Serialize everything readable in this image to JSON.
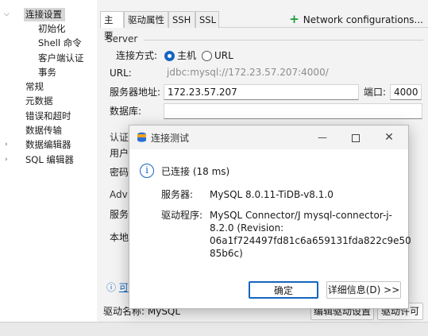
{
  "tree": {
    "items": [
      {
        "label": "连接设置",
        "expanded": true
      },
      {
        "label": "初始化"
      },
      {
        "label": "Shell 命令"
      },
      {
        "label": "客户端认证"
      },
      {
        "label": "事务"
      },
      {
        "label": "常规"
      },
      {
        "label": "元数据"
      },
      {
        "label": "错误和超时"
      },
      {
        "label": "数据传输"
      },
      {
        "label": "数据编辑器",
        "collapsed": true
      },
      {
        "label": "SQL 编辑器",
        "collapsed": true
      }
    ]
  },
  "tabs": [
    {
      "label": "主要"
    },
    {
      "label": "驱动属性"
    },
    {
      "label": "SSH"
    },
    {
      "label": "SSL"
    }
  ],
  "network_config_label": "Network configurations...",
  "server": {
    "group_title": "Server",
    "connect_by_label": "连接方式:",
    "option_host": "主机",
    "option_url": "URL",
    "url_label": "URL:",
    "url_value": "jdbc:mysql://172.23.57.207:4000/",
    "host_label": "服务器地址:",
    "host_value": "172.23.57.207",
    "port_label": "端口:",
    "port_value": "4000",
    "db_label": "数据库:",
    "db_value": ""
  },
  "auth": {
    "group_title": "认证",
    "user_label": "用户",
    "password_label": "密码"
  },
  "advanced": {
    "group_title": "Adv",
    "row1_label": "服务",
    "row2_label": "本地"
  },
  "info_link_label": "可",
  "driver_name_label": "驱动名称: MySQL",
  "edit_driver_button": "编辑驱动设置",
  "driver_license_button": "驱动许可",
  "dialog": {
    "title": "连接测试",
    "status": "已连接 (18 ms)",
    "server_label": "服务器:",
    "server_value": "MySQL 8.0.11-TiDB-v8.1.0",
    "driver_label": "驱动程序:",
    "driver_value": "MySQL Connector/J mysql-connector-j-\n8.2.0 (Revision:\n06a1f724497fd81c6a659131fda822c9e50\n85b6c)",
    "ok_button": "确定",
    "details_button": "详细信息(D) >>",
    "minimize_icon": "minimize-icon",
    "maximize_icon": "maximize-icon",
    "close_icon": "close-icon"
  },
  "colors": {
    "accent": "#1565c0",
    "add_green": "#1d9c3f",
    "dialog_icon_blue": "#2b6fd6"
  }
}
